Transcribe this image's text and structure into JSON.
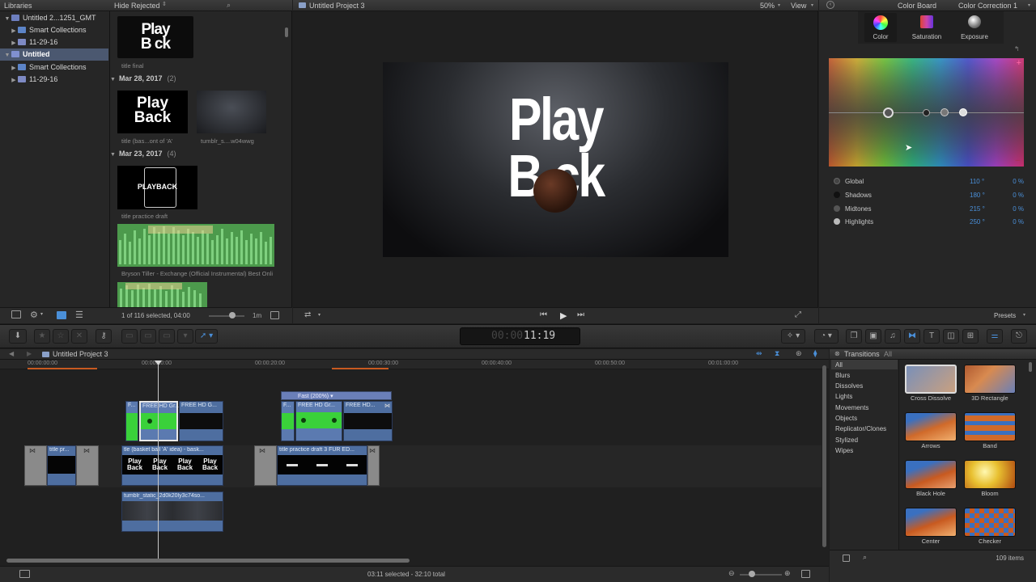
{
  "libraries": {
    "header": "Libraries",
    "items": [
      {
        "label": "Untitled 2...1251_GMT",
        "indent": 0
      },
      {
        "label": "Smart Collections",
        "indent": 1
      },
      {
        "label": "11-29-16",
        "indent": 1
      },
      {
        "label": "Untitled",
        "indent": 0
      },
      {
        "label": "Smart Collections",
        "indent": 1
      },
      {
        "label": "11-29-16",
        "indent": 1
      }
    ]
  },
  "browser": {
    "filter": "Hide Rejected",
    "groups": [
      {
        "date": "Mar 28, 2017",
        "count": "(2)"
      },
      {
        "date": "Mar 23, 2017",
        "count": "(4)"
      }
    ],
    "captions": {
      "title_final": "title final",
      "title_bas": "title (bas...ont of 'A'",
      "tumblr": "tumblr_s....w04wwg",
      "title_practice": "title practice draft",
      "bryson": "Bryson Tiller - Exchange (Official Instrumental) Best Onli"
    },
    "thumb_texts": {
      "play": "Play",
      "back": "Back",
      "play_b": "Play",
      "b_ck": "B  ck",
      "playback": "PLAYBACK"
    },
    "status": "1 of 116 selected, 04:00",
    "zoom": "1m"
  },
  "viewer": {
    "title": "Untitled Project 3",
    "zoom": "50%",
    "view": "View",
    "frame_line1": "Play",
    "frame_line2": "B  ck"
  },
  "inspector": {
    "title": "Color Board",
    "correction": "Color Correction 1",
    "tabs": [
      "Color",
      "Saturation",
      "Exposure"
    ],
    "rows": [
      {
        "label": "Global",
        "angle": "110 °",
        "pct": "0 %"
      },
      {
        "label": "Shadows",
        "angle": "180 °",
        "pct": "0 %"
      },
      {
        "label": "Midtones",
        "angle": "215 °",
        "pct": "0 %"
      },
      {
        "label": "Highlights",
        "angle": "250 °",
        "pct": "0 %"
      }
    ],
    "presets": "Presets"
  },
  "toolbar": {
    "timecode": "11:19",
    "timecode_dim": "00:00"
  },
  "timeline": {
    "project": "Untitled Project 3",
    "ruler": [
      "00:00:00:00",
      "00:00:10:00",
      "00:00:20:00",
      "00:00:30:00",
      "00:00:40:00",
      "00:00:50:00",
      "00:01:00:00"
    ],
    "clips": {
      "free_hd_1": "FREE HD Gr...",
      "free_hd_2": "FREE HD G...",
      "f1": "F...",
      "fast": "Fast (200%) ▾",
      "free_hd_3": "FREE HD Gr...",
      "free_hd_4": "FREE HD...",
      "f2": "F...",
      "title_pr": "title pr...",
      "basketball": "tle (basket ball 'A' idea) - bask...",
      "practice3": "title practice draft 3 FUR ED...",
      "tumblr_static": "tumblr_static_2d0k20ly3c74so..."
    },
    "status": "03:11 selected - 32:10 total"
  },
  "transitions": {
    "title": "Transitions",
    "filter": "All",
    "categories": [
      "All",
      "Blurs",
      "Dissolves",
      "Lights",
      "Movements",
      "Objects",
      "Replicator/Clones",
      "Stylized",
      "Wipes"
    ],
    "items": [
      "Cross Dissolve",
      "3D Rectangle",
      "Arrows",
      "Band",
      "Black Hole",
      "Bloom",
      "Center",
      "Checker"
    ],
    "count": "109 items"
  }
}
